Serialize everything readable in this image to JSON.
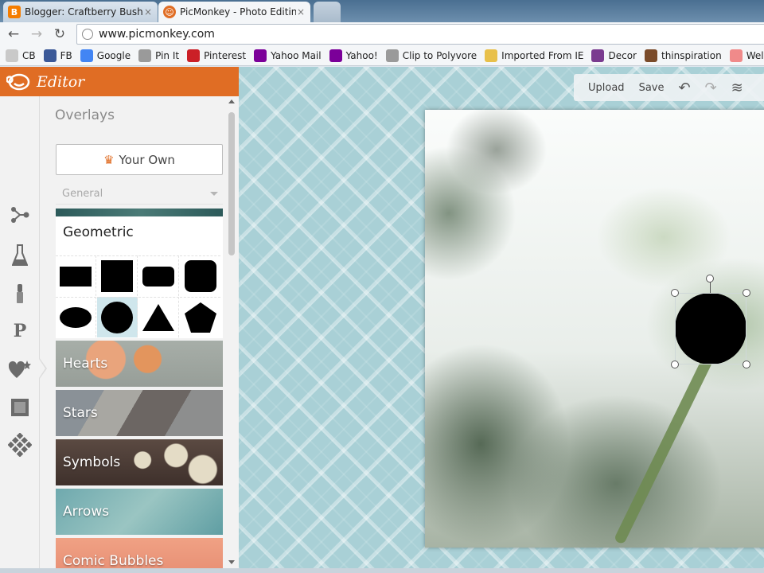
{
  "browser": {
    "tabs": [
      {
        "title": "Blogger: Craftberry Bush -",
        "favicon": "blogger-icon",
        "close": "×"
      },
      {
        "title": "PicMonkey - Photo Editing",
        "favicon": "picmonkey-icon",
        "close": "×"
      },
      {
        "title": "",
        "favicon": "new-tab-icon",
        "close": ""
      }
    ],
    "url": "www.picmonkey.com",
    "bookmarks": [
      {
        "label": "CB",
        "icon": "cb-icon",
        "color": "#c9c9c9"
      },
      {
        "label": "FB",
        "icon": "facebook-icon",
        "color": "#3b5998"
      },
      {
        "label": "Google",
        "icon": "google-icon",
        "color": "#4285f4"
      },
      {
        "label": "Pin It",
        "icon": "globe-icon",
        "color": "#9a9a9a"
      },
      {
        "label": "Pinterest",
        "icon": "pinterest-icon",
        "color": "#cb2027"
      },
      {
        "label": "Yahoo Mail",
        "icon": "yahoo-icon",
        "color": "#7b0099"
      },
      {
        "label": "Yahoo!",
        "icon": "yahoo-icon",
        "color": "#7b0099"
      },
      {
        "label": "Clip to Polyvore",
        "icon": "globe-icon",
        "color": "#9a9a9a"
      },
      {
        "label": "Imported From IE",
        "icon": "folder-icon",
        "color": "#e8c04a"
      },
      {
        "label": "Decor",
        "icon": "heart-icon",
        "color": "#7a3b8f"
      },
      {
        "label": "thinspiration",
        "icon": "photo-icon",
        "color": "#7a4b2a"
      },
      {
        "label": "Welcome to",
        "icon": "heart-icon",
        "color": "#f08a8a"
      }
    ]
  },
  "editor": {
    "header_title": "Editor",
    "section_title": "Overlays",
    "your_own_label": "Your Own",
    "category_select": "General",
    "geometric": {
      "title": "Geometric",
      "shapes": [
        "rectangle",
        "square",
        "rounded-rectangle",
        "rounded-square",
        "ellipse",
        "circle",
        "triangle",
        "pentagon"
      ],
      "selected_shape": "circle"
    },
    "categories": [
      "Hearts",
      "Stars",
      "Symbols",
      "Arrows",
      "Comic Bubbles"
    ],
    "rail_icons": [
      "effects-icon",
      "touch-up-icon",
      "text-icon",
      "overlays-icon",
      "frames-icon",
      "textures-icon"
    ],
    "active_tool": "overlays-icon"
  },
  "canvas": {
    "toolbar": {
      "upload": "Upload",
      "save": "Save"
    }
  },
  "colors": {
    "accent": "#e06d24",
    "canvas_bg": "#a9d0d6",
    "selected_cell": "#cfe6ec"
  }
}
